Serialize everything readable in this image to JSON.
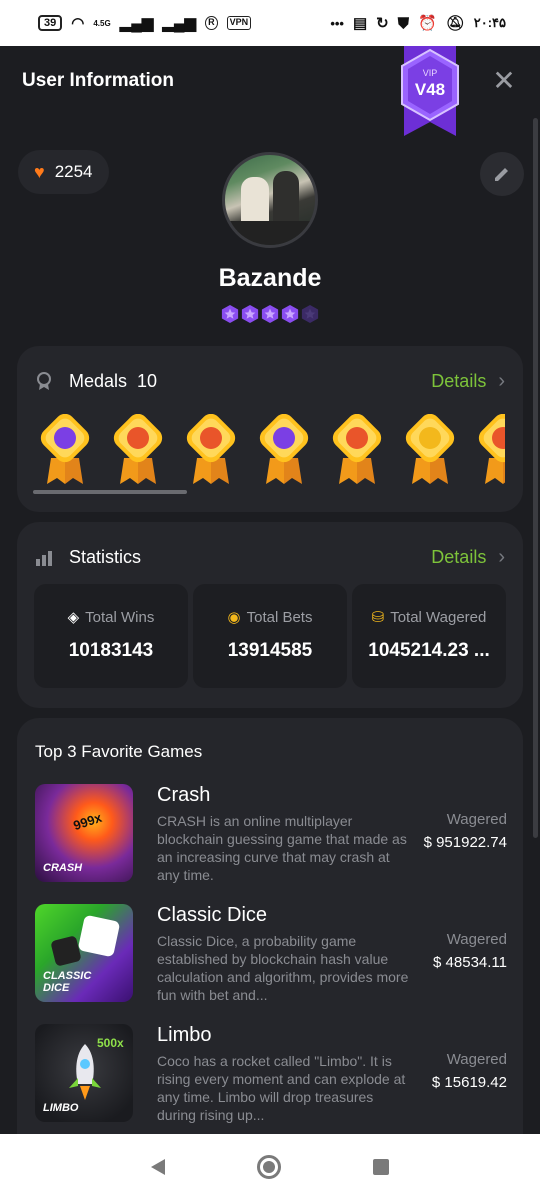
{
  "status_bar": {
    "battery": "39",
    "network_label": "4.5G",
    "r_icon": "R",
    "vpn_label": "VPN",
    "dots": "•••",
    "time": "۲۰:۴۵"
  },
  "header": {
    "title": "User Information",
    "vip_label": "VIP",
    "vip_level": "V48",
    "close_icon": "close-icon"
  },
  "profile": {
    "likes": "2254",
    "username": "Bazande",
    "stars_filled": 4,
    "stars_total": 5
  },
  "medals": {
    "title": "Medals",
    "count": "10",
    "details_label": "Details",
    "items": [
      {
        "icon": "chat-medal",
        "color": "#7b3fe4"
      },
      {
        "icon": "crab-medal",
        "color": "#e9552a"
      },
      {
        "icon": "crab-medal",
        "color": "#e9552a"
      },
      {
        "icon": "star-medal",
        "color": "#7b3fe4"
      },
      {
        "icon": "crab-medal",
        "color": "#e9552a"
      },
      {
        "icon": "coins-medal",
        "color": "#f3b81c"
      },
      {
        "icon": "crab-medal",
        "color": "#e9552a"
      }
    ]
  },
  "statistics": {
    "title": "Statistics",
    "details_label": "Details",
    "items": [
      {
        "label": "Total Wins",
        "value": "10183143"
      },
      {
        "label": "Total Bets",
        "value": "13914585"
      },
      {
        "label": "Total Wagered",
        "value": "1045214.23 ..."
      }
    ]
  },
  "favorites": {
    "title": "Top 3 Favorite Games",
    "games": [
      {
        "name": "Crash",
        "thumb_text": "CRASH",
        "thumb_badge": "999x",
        "description": "CRASH is an online multiplayer blockchain guessing game that made as an increasing curve that may crash at any time.",
        "wagered_label": "Wagered",
        "wagered_value": "$ 951922.74"
      },
      {
        "name": "Classic Dice",
        "thumb_text": "CLASSIC DICE",
        "thumb_badge": "",
        "description": "Classic Dice, a probability game established by blockchain hash value calculation and algorithm, provides more fun with bet and...",
        "wagered_label": "Wagered",
        "wagered_value": "$ 48534.11"
      },
      {
        "name": "Limbo",
        "thumb_text": "LIMBO",
        "thumb_badge": "500x",
        "description": "Coco has a rocket called \"Limbo\". It is rising every moment and can explode at any time. Limbo will drop treasures during rising up...",
        "wagered_label": "Wagered",
        "wagered_value": "$ 15619.42"
      }
    ]
  },
  "colors": {
    "accent_green": "#7dc33a",
    "vip_purple": "#7b3fe4",
    "heart_orange": "#ff7a1a",
    "card_bg": "#25262b"
  }
}
